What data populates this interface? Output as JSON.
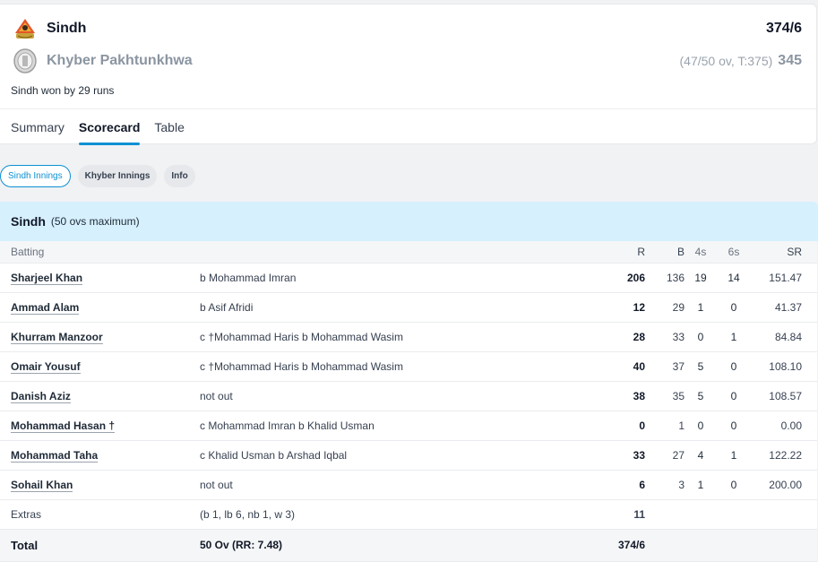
{
  "match": {
    "team1": {
      "name": "Sindh",
      "score": "374/6",
      "logo_icon": "sindh-crest-icon"
    },
    "team2": {
      "name": "Khyber Pakhtunkhwa",
      "overs_info": "(47/50 ov, T:375)",
      "score": "345",
      "logo_icon": "kp-crest-icon"
    },
    "result": "Sindh won by 29 runs"
  },
  "tabs": [
    {
      "label": "Summary",
      "active": false
    },
    {
      "label": "Scorecard",
      "active": true
    },
    {
      "label": "Table",
      "active": false
    }
  ],
  "pills": [
    {
      "label": "Sindh Innings",
      "active": true
    },
    {
      "label": "Khyber Innings",
      "active": false
    },
    {
      "label": "Info",
      "active": false
    }
  ],
  "innings": {
    "title": "Sindh",
    "subtitle": "(50 ovs maximum)",
    "headers": {
      "batting": "Batting",
      "r": "R",
      "b": "B",
      "fours": "4s",
      "sixes": "6s",
      "sr": "SR"
    },
    "batters": [
      {
        "name": "Sharjeel Khan",
        "dismissal": "b Mohammad Imran",
        "r": "206",
        "b": "136",
        "fours": "19",
        "sixes": "14",
        "sr": "151.47"
      },
      {
        "name": "Ammad Alam",
        "dismissal": "b Asif Afridi",
        "r": "12",
        "b": "29",
        "fours": "1",
        "sixes": "0",
        "sr": "41.37"
      },
      {
        "name": "Khurram Manzoor",
        "dismissal": "c †Mohammad Haris b Mohammad Wasim",
        "r": "28",
        "b": "33",
        "fours": "0",
        "sixes": "1",
        "sr": "84.84"
      },
      {
        "name": "Omair Yousuf",
        "dismissal": "c †Mohammad Haris b Mohammad Wasim",
        "r": "40",
        "b": "37",
        "fours": "5",
        "sixes": "0",
        "sr": "108.10"
      },
      {
        "name": "Danish Aziz",
        "dismissal": "not out",
        "r": "38",
        "b": "35",
        "fours": "5",
        "sixes": "0",
        "sr": "108.57"
      },
      {
        "name": "Mohammad Hasan †",
        "dismissal": "c Mohammad Imran b Khalid Usman",
        "r": "0",
        "b": "1",
        "fours": "0",
        "sixes": "0",
        "sr": "0.00"
      },
      {
        "name": "Mohammad Taha",
        "dismissal": "c Khalid Usman b Arshad Iqbal",
        "r": "33",
        "b": "27",
        "fours": "4",
        "sixes": "1",
        "sr": "122.22"
      },
      {
        "name": "Sohail Khan",
        "dismissal": "not out",
        "r": "6",
        "b": "3",
        "fours": "1",
        "sixes": "0",
        "sr": "200.00"
      }
    ],
    "extras": {
      "label": "Extras",
      "detail": "(b 1, lb 6, nb 1, w 3)",
      "value": "11"
    },
    "total": {
      "label": "Total",
      "detail": "50 Ov (RR: 7.48)",
      "value": "374/6"
    }
  },
  "colors": {
    "accent": "#0b91d3",
    "innings_header_bg": "#d6f0fd",
    "muted_text": "#8b95a1"
  }
}
